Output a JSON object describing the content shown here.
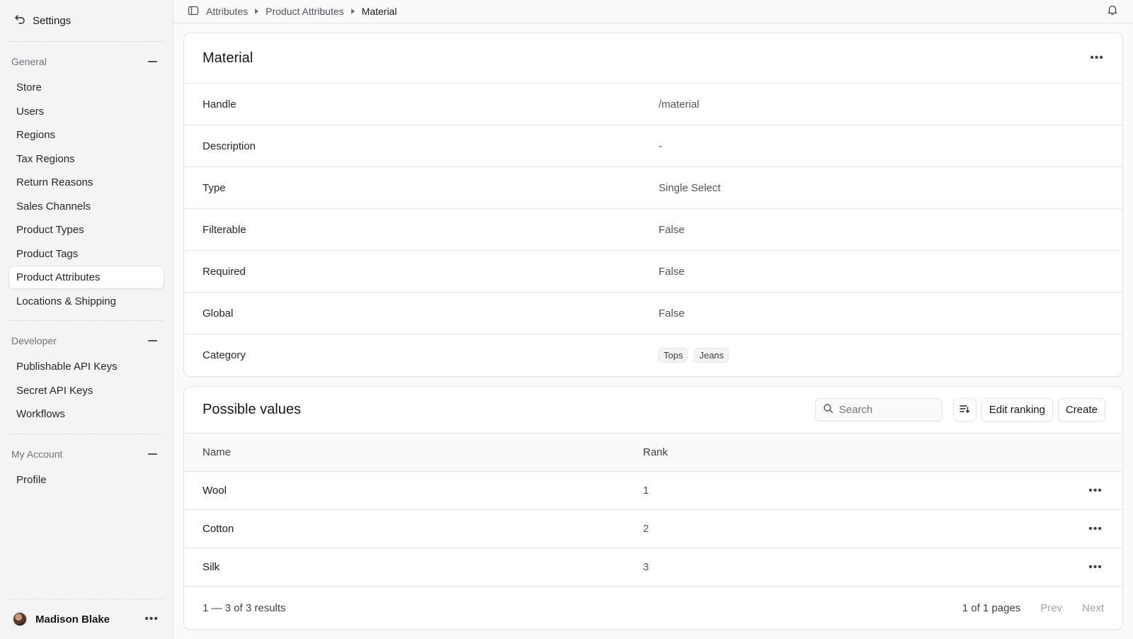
{
  "sidebar": {
    "header_label": "Settings",
    "sections": [
      {
        "title": "General",
        "items": [
          "Store",
          "Users",
          "Regions",
          "Tax Regions",
          "Return Reasons",
          "Sales Channels",
          "Product Types",
          "Product Tags",
          "Product Attributes",
          "Locations & Shipping"
        ]
      },
      {
        "title": "Developer",
        "items": [
          "Publishable API Keys",
          "Secret API Keys",
          "Workflows"
        ]
      },
      {
        "title": "My Account",
        "items": [
          "Profile"
        ]
      }
    ],
    "active_item": "Product Attributes",
    "user_name": "Madison Blake"
  },
  "breadcrumb": {
    "items": [
      "Attributes",
      "Product Attributes",
      "Material"
    ]
  },
  "attribute": {
    "title": "Material",
    "rows": [
      {
        "label": "Handle",
        "value": "/material"
      },
      {
        "label": "Description",
        "value": "-"
      },
      {
        "label": "Type",
        "value": "Single Select"
      },
      {
        "label": "Filterable",
        "value": "False"
      },
      {
        "label": "Required",
        "value": "False"
      },
      {
        "label": "Global",
        "value": "False"
      }
    ],
    "category_label": "Category",
    "categories": [
      "Tops",
      "Jeans"
    ]
  },
  "possible_values": {
    "title": "Possible values",
    "search_placeholder": "Search",
    "edit_ranking_label": "Edit ranking",
    "create_label": "Create",
    "columns": {
      "name": "Name",
      "rank": "Rank"
    },
    "rows": [
      {
        "name": "Wool",
        "rank": "1"
      },
      {
        "name": "Cotton",
        "rank": "2"
      },
      {
        "name": "Silk",
        "rank": "3"
      }
    ],
    "pagination": {
      "count": "1 — 3 of 3 results",
      "pages": "1 of 1 pages",
      "prev": "Prev",
      "next": "Next"
    }
  },
  "icons": {
    "back": "arrow-back-icon",
    "sidebar_toggle": "sidebar-toggle-icon",
    "bell": "bell-icon",
    "search": "search-icon",
    "sort": "sort-icon",
    "more": "more-horizontal-icon"
  }
}
